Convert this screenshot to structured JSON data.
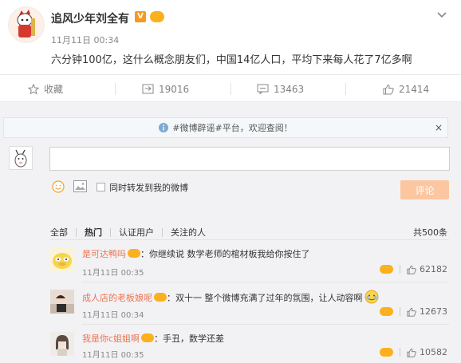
{
  "post": {
    "author": "追风少年刘全有",
    "verified_badge": "V",
    "time": "11月11日 00:34",
    "text": "六分钟100亿，这什么概念朋友们，中国14亿人口，平均下来每人花了7亿多啊"
  },
  "actions": {
    "favorite_label": "收藏",
    "repost_count": "19016",
    "comment_count": "13463",
    "like_count": "21414"
  },
  "notice": {
    "text": "#微博辟谣#平台，欢迎查阅！",
    "close": "×"
  },
  "composer": {
    "forward_label": "同时转发到我的微博",
    "submit_label": "评论"
  },
  "filters": {
    "items": [
      "全部",
      "热门",
      "认证用户",
      "关注的人"
    ],
    "total": "共500条"
  },
  "comments": [
    {
      "user": "是可达鸭吗",
      "text": "：你继续说 数学老师的棺材板我给你按住了",
      "time": "11月11日 00:35",
      "likes": "62182"
    },
    {
      "user": "成人店的老板娘呢",
      "text": "：双十一   整个微博充满了过年的氛围，让人动容啊",
      "time": "11月11日 00:34",
      "likes": "12673"
    },
    {
      "user": "我是你c姐姐啊",
      "text": "：手丑，数学还差",
      "time": "11月11日 00:35",
      "likes": "10582"
    }
  ],
  "colors": {
    "accent": "#eb7350",
    "submit_bg": "#fcc6a0",
    "badge_orange": "#f49a22"
  }
}
